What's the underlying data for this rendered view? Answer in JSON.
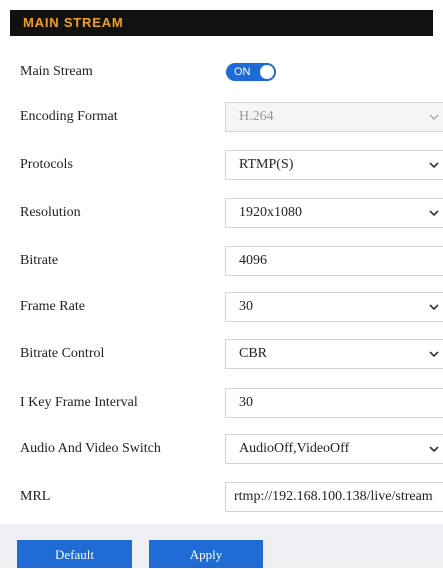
{
  "header": {
    "title": "MAIN STREAM"
  },
  "fields": {
    "main_stream": {
      "label": "Main Stream",
      "toggle_text": "ON",
      "enabled": true
    },
    "encoding_format": {
      "label": "Encoding Format",
      "value": "H.264"
    },
    "protocols": {
      "label": "Protocols",
      "value": "RTMP(S)"
    },
    "resolution": {
      "label": "Resolution",
      "value": "1920x1080"
    },
    "bitrate": {
      "label": "Bitrate",
      "value": "4096"
    },
    "frame_rate": {
      "label": "Frame Rate",
      "value": "30"
    },
    "bitrate_control": {
      "label": "Bitrate Control",
      "value": "CBR"
    },
    "i_key_frame_interval": {
      "label": "I Key Frame Interval",
      "value": "30"
    },
    "audio_video_switch": {
      "label": "Audio And Video Switch",
      "value": "AudioOff,VideoOff"
    },
    "mrl": {
      "label": "MRL",
      "value": "rtmp://192.168.100.138/live/stream"
    }
  },
  "buttons": {
    "default_label": "Default",
    "apply_label": "Apply"
  },
  "colors": {
    "header_bg": "#111111",
    "header_text": "#f0a020",
    "accent": "#1e6bd6"
  }
}
